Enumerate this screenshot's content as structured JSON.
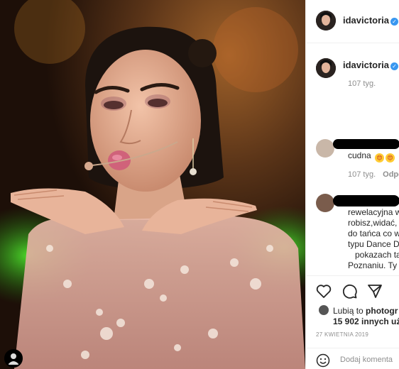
{
  "post": {
    "username": "idavictoria",
    "verified_mark": "✓",
    "icons": {
      "verified": "verified-badge-icon",
      "like": "heart-icon",
      "comment": "speech-bubble-icon",
      "share": "paper-plane-icon",
      "emoji": "emoji-icon"
    }
  },
  "caption": {
    "username": "idavictoria",
    "time": "107 tyg."
  },
  "comments": [
    {
      "text": "cudna",
      "emoji": [
        "😍",
        "😍"
      ],
      "time": "107 tyg.",
      "reply_label": "Odpo"
    },
    {
      "lines": [
        "rewelacyjna w",
        "robisz,widać,",
        "do tańca co w",
        "typu Dance D",
        "pokazach tan",
        "Poznaniu. Ty"
      ]
    }
  ],
  "likes": {
    "prefix": "Lubią to ",
    "liker": "photogr",
    "count_line": "15 902 innych uż"
  },
  "date": "27 KWIETNIA 2019",
  "add_comment_placeholder": "Dodaj komenta",
  "colors": {
    "accent_blue": "#3897f0",
    "text": "#262626",
    "secondary_text": "#8e8e8e",
    "divider": "#efefef"
  }
}
